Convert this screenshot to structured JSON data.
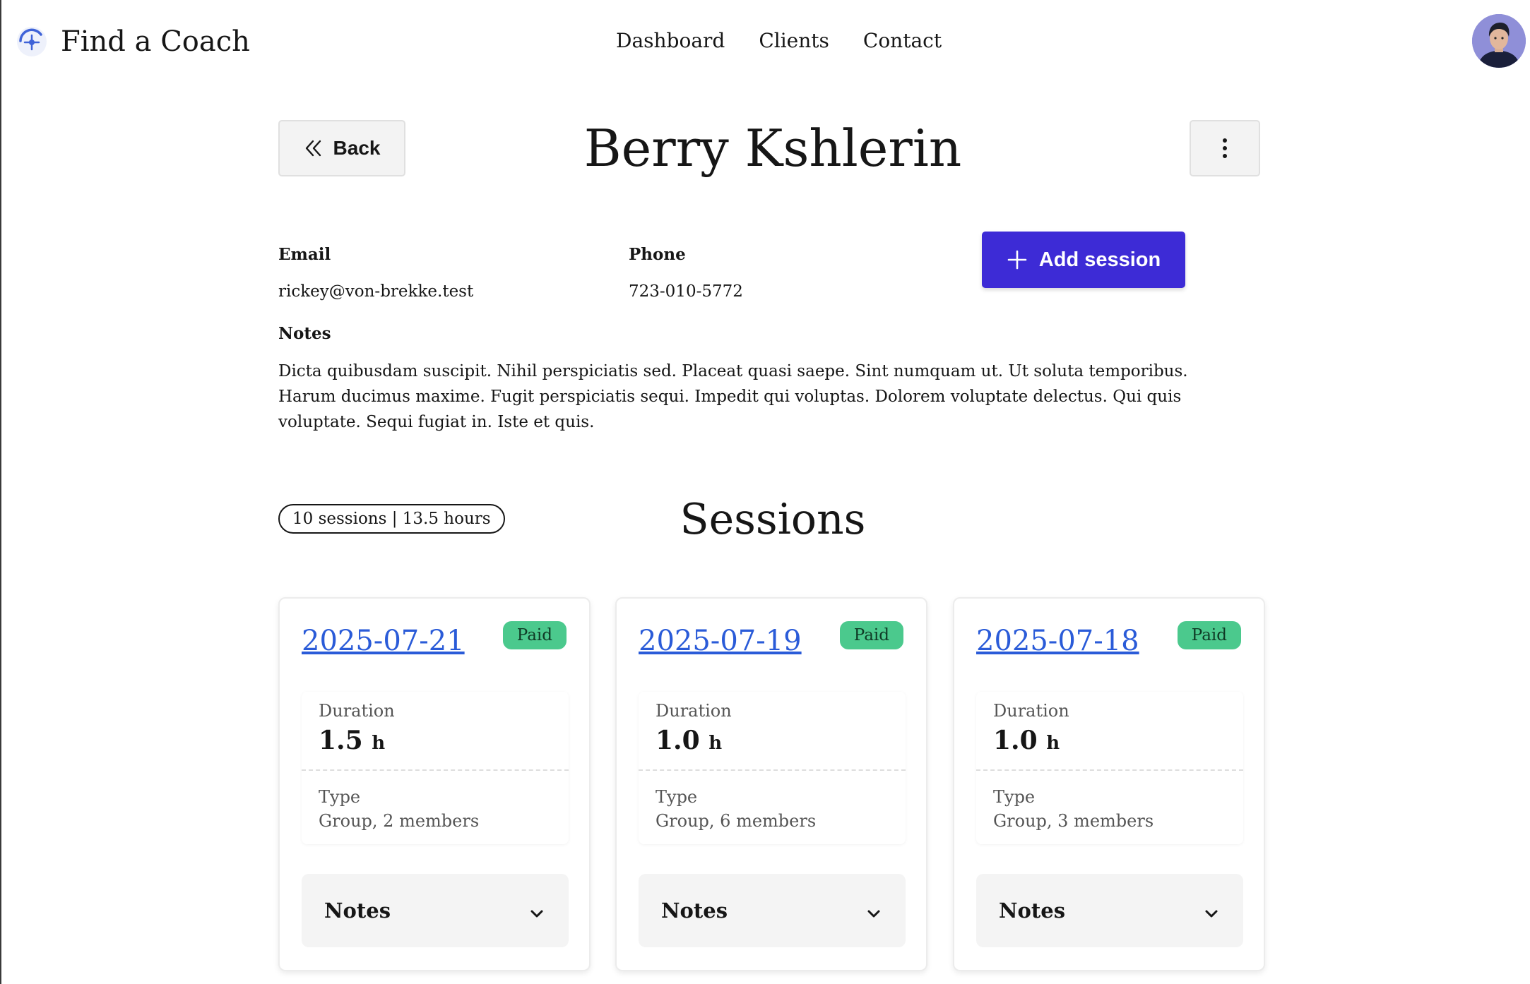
{
  "app": {
    "title": "Find a Coach"
  },
  "nav": {
    "items": [
      "Dashboard",
      "Clients",
      "Contact"
    ]
  },
  "header": {
    "back_label": "Back",
    "client_name": "Berry Kshlerin"
  },
  "client": {
    "email_label": "Email",
    "email": "rickey@von-brekke.test",
    "phone_label": "Phone",
    "phone": "723-010-5772",
    "notes_label": "Notes",
    "notes": "Dicta quibusdam suscipit. Nihil perspiciatis sed. Placeat quasi saepe. Sint numquam ut. Ut soluta temporibus. Harum ducimus maxime. Fugit perspiciatis sequi. Impedit qui voluptas. Dolorem voluptate delectus. Qui quis voluptate. Sequi fugiat in. Iste et quis."
  },
  "actions": {
    "add_session_label": "Add session"
  },
  "sessions": {
    "title": "Sessions",
    "summary": "10 sessions | 13.5 hours",
    "items": [
      {
        "date": "2025-07-21",
        "status": "Paid",
        "duration_label": "Duration",
        "duration": "1.5",
        "unit": "h",
        "type_label": "Type",
        "type": "Group, 2 members",
        "notes_label": "Notes"
      },
      {
        "date": "2025-07-19",
        "status": "Paid",
        "duration_label": "Duration",
        "duration": "1.0",
        "unit": "h",
        "type_label": "Type",
        "type": "Group, 6 members",
        "notes_label": "Notes"
      },
      {
        "date": "2025-07-18",
        "status": "Paid",
        "duration_label": "Duration",
        "duration": "1.0",
        "unit": "h",
        "type_label": "Type",
        "type": "Group, 3 members",
        "notes_label": "Notes"
      }
    ]
  },
  "colors": {
    "accent": "#3d2bd6",
    "link": "#2a5bd8",
    "paid_badge": "#4bc98d"
  },
  "icons": {
    "logo": "coach-logo-icon",
    "back": "chevrons-left-icon",
    "more": "vertical-dots-icon",
    "add": "plus-icon",
    "expand": "chevron-down-icon"
  }
}
